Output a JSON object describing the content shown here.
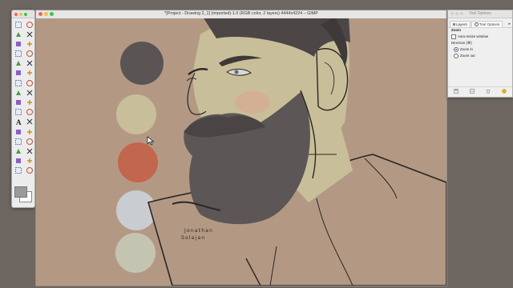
{
  "window": {
    "title": "*[Project - Drawing 2_1] (imported)-1.0 (RGB color, 2 layers) 4444x4224 – GIMP",
    "traffic_lights": [
      "#fc605b",
      "#fdbc40",
      "#34c84a"
    ]
  },
  "toolbox": {
    "tools": [
      "rect-select-icon",
      "ellipse-select-icon",
      "free-select-icon",
      "fuzzy-select-icon",
      "color-select-icon",
      "scissors-icon",
      "foreground-select-icon",
      "paths-icon",
      "color-picker-icon",
      "zoom-icon",
      "measure-icon",
      "move-icon",
      "align-icon",
      "crop-icon",
      "rotate-icon",
      "scale-icon",
      "shear-icon",
      "perspective-icon",
      "flip-icon",
      "cage-icon",
      "text-icon",
      "bucket-fill-icon",
      "blend-icon",
      "pencil-icon",
      "paintbrush-icon",
      "eraser-icon",
      "airbrush-icon",
      "ink-icon",
      "clone-icon",
      "heal-icon",
      "smudge-icon",
      "dodge-icon"
    ],
    "foreground_color": "#9a9a9a",
    "background_color": "#ffffff"
  },
  "dock": {
    "title": "Tool Options",
    "tabs": [
      {
        "label": "Layers"
      },
      {
        "label": "Tool Options"
      }
    ],
    "section": "Zoom",
    "auto_resize": "Auto-resize window",
    "direction_label": "Direction  (⌘)",
    "zoom_in": "Zoom in",
    "zoom_out": "Zoom out",
    "selected": "Zoom in"
  },
  "canvas": {
    "background": "#b39984",
    "palette": [
      "#5a5554",
      "#c8bf9a",
      "#c2664d",
      "#c9cdd2",
      "#c4c4b2"
    ],
    "signature_line1": "Jonathan",
    "signature_line2": "Solajan"
  }
}
